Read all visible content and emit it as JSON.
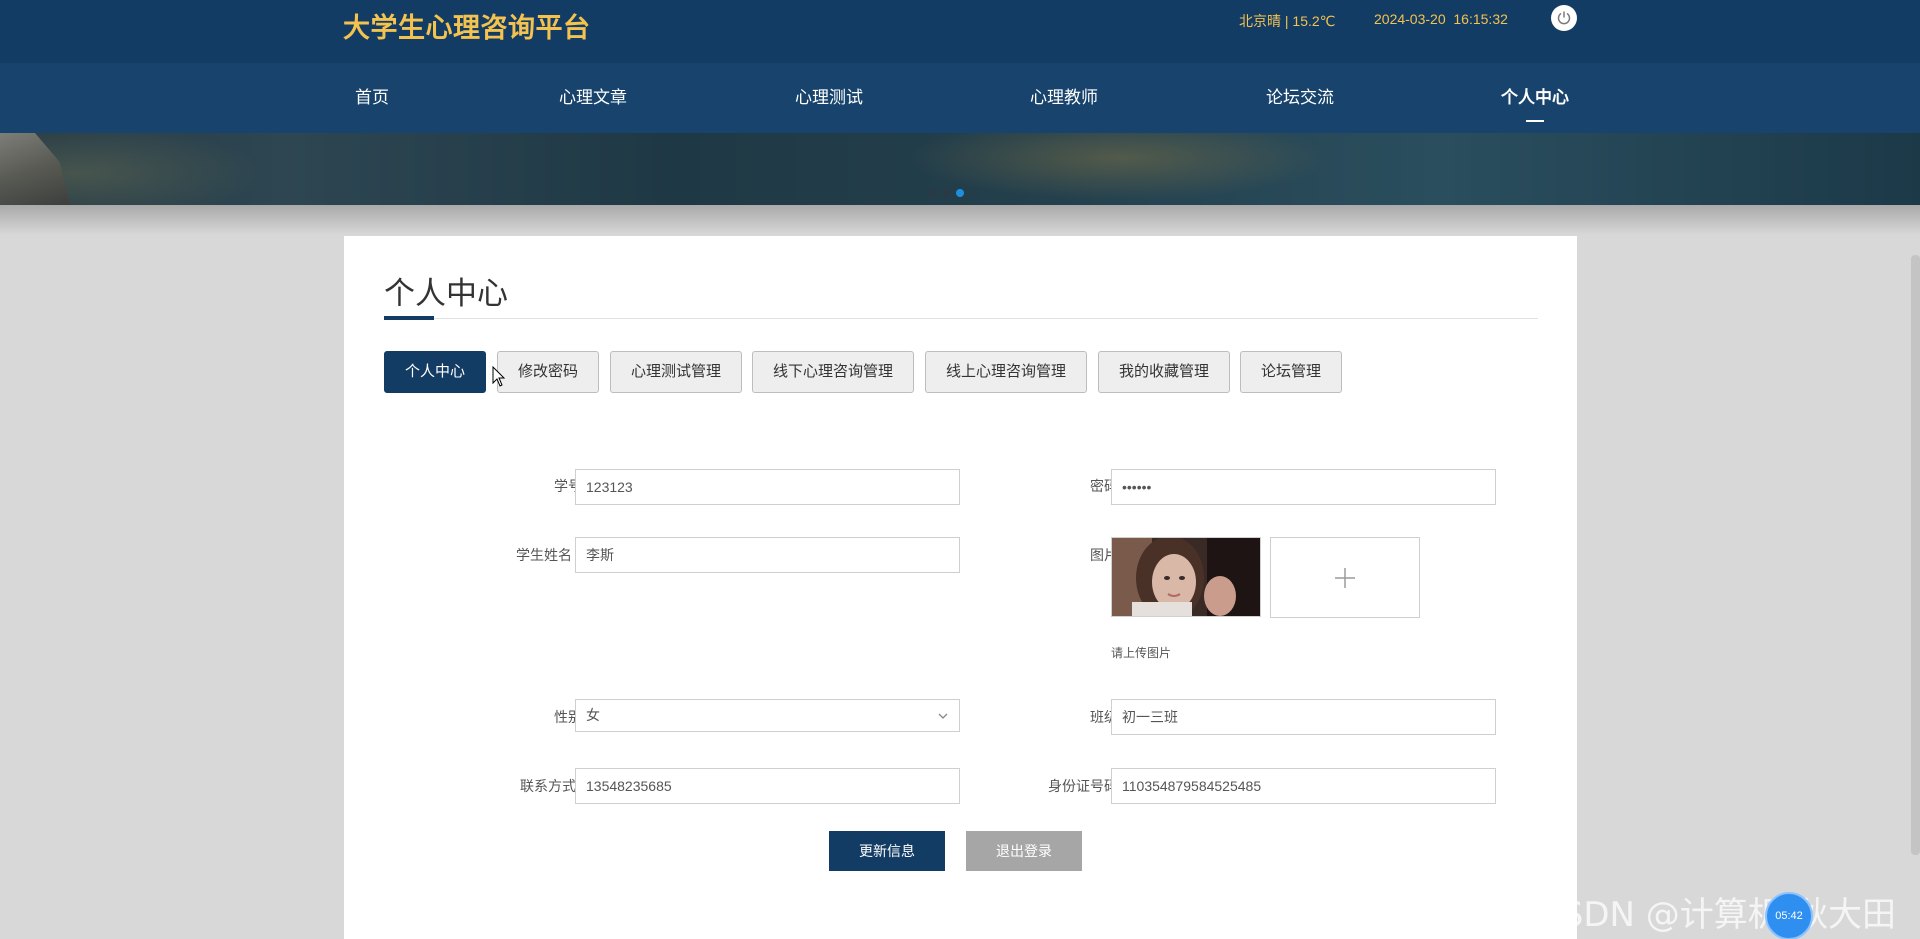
{
  "header": {
    "site_title": "大学生心理咨询平台",
    "weather": "北京晴 | 15.2℃",
    "datetime": "2024-03-20  16:15:32",
    "power_icon": "power-icon"
  },
  "nav": {
    "items": [
      {
        "label": "首页"
      },
      {
        "label": "心理文章"
      },
      {
        "label": "心理测试"
      },
      {
        "label": "心理教师"
      },
      {
        "label": "论坛交流"
      },
      {
        "label": "个人中心",
        "active": true
      }
    ]
  },
  "banner": {
    "slides": 3,
    "active_slide": 3
  },
  "main": {
    "heading": "个人中心",
    "tabs": [
      {
        "label": "个人中心",
        "active": true
      },
      {
        "label": "修改密码"
      },
      {
        "label": "心理测试管理"
      },
      {
        "label": "线下心理咨询管理"
      },
      {
        "label": "线上心理咨询管理"
      },
      {
        "label": "我的收藏管理"
      },
      {
        "label": "论坛管理"
      }
    ],
    "form": {
      "student_id_label": "学号",
      "student_id_value": "123123",
      "password_label": "密码",
      "password_value": "••••••",
      "student_name_label": "学生姓名",
      "student_name_value": "李斯",
      "photo_label": "图片",
      "upload_hint": "请上传图片",
      "gender_label": "性别",
      "gender_value": "女",
      "class_label": "班级",
      "class_value": "初一三班",
      "contact_label": "联系方式",
      "contact_value": "13548235685",
      "id_card_label": "身份证号码",
      "id_card_value": "110354879584525485"
    },
    "buttons": {
      "update": "更新信息",
      "logout": "退出登录"
    }
  },
  "overlay": {
    "watermark": "CSDN @计算机-秋大田",
    "badge_text": "05:42"
  },
  "colors": {
    "header_bg": "#133c64",
    "nav_bg": "#17436c",
    "title_gold": "#f3c24f",
    "primary": "#133c64",
    "secondary_btn": "#a6a6a6"
  }
}
